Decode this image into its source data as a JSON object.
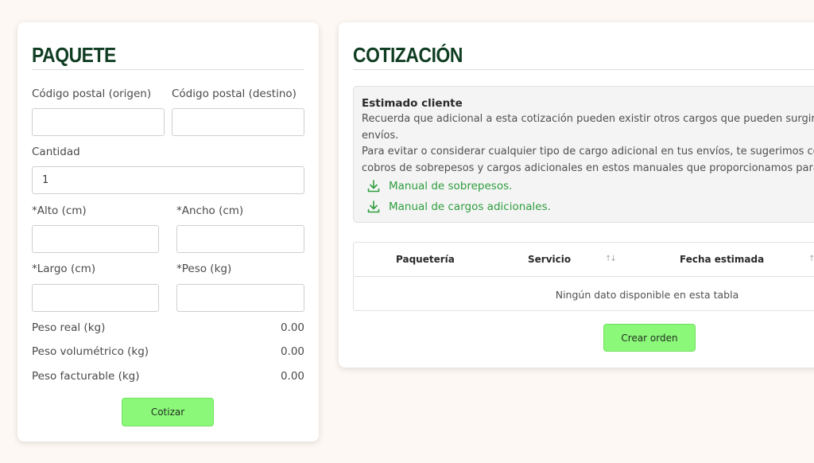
{
  "paquete": {
    "title": "PAQUETE",
    "cp_origen_label": "Código postal (origen)",
    "cp_destino_label": "Código postal (destino)",
    "cp_origen_value": "",
    "cp_destino_value": "",
    "cantidad_label": "Cantidad",
    "cantidad_value": "1",
    "alto_label": "*Alto (cm)",
    "ancho_label": "*Ancho (cm)",
    "largo_label": "*Largo (cm)",
    "peso_label": "*Peso (kg)",
    "alto_value": "",
    "ancho_value": "",
    "largo_value": "",
    "peso_value": "",
    "summary": [
      {
        "label": "Peso real (kg)",
        "value": "0.00"
      },
      {
        "label": "Peso volumétrico (kg)",
        "value": "0.00"
      },
      {
        "label": "Peso facturable (kg)",
        "value": "0.00"
      }
    ],
    "cotizar_button": "Cotizar"
  },
  "cotizacion": {
    "title": "COTIZACIÓN",
    "notice": {
      "heading": "Estimado cliente",
      "lines": [
        "Recuerda que adicional a esta cotización pueden existir otros cargos que pueden surgir en",
        "envíos.",
        "Para evitar o considerar cualquier tipo de cargo adicional en tus envíos, te sugerimos conoc",
        "cobros de sobrepesos y cargos adicionales en estos manuales que proporcionamos para"
      ],
      "links": [
        {
          "label": "Manual de sobrepesos.",
          "icon": "download-icon"
        },
        {
          "label": "Manual de cargos adicionales.",
          "icon": "download-icon"
        }
      ]
    },
    "table": {
      "columns": [
        "Paquetería",
        "Servicio",
        "Fecha estimada"
      ],
      "empty_message": "Ningún dato disponible en esta tabla"
    },
    "crear_orden_button": "Crear orden"
  },
  "colors": {
    "background": "#fdf8f3",
    "title": "#0f3d22",
    "button": "#8cf87a",
    "link": "#2f9e3f"
  }
}
